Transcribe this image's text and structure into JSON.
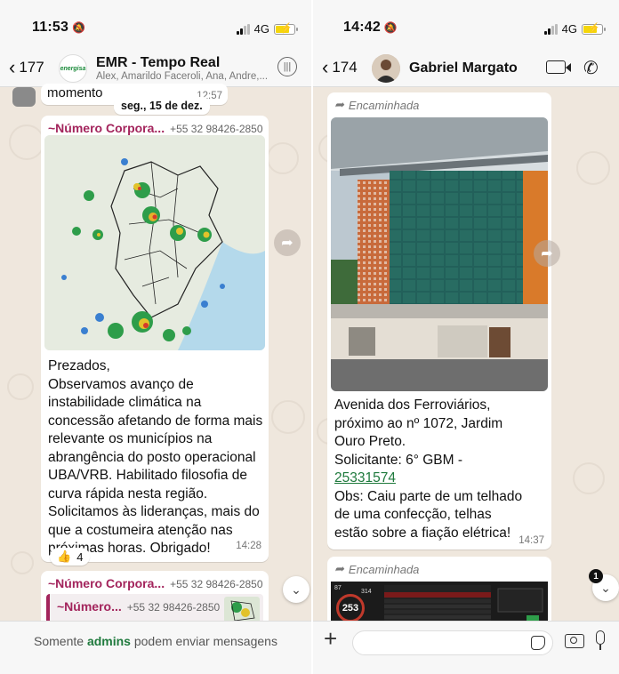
{
  "left": {
    "status": {
      "time": "11:53",
      "network": "4G"
    },
    "header": {
      "back_count": "177",
      "logo_text": "energisa",
      "title": "EMR - Tempo Real",
      "subtitle": "Alex, Amarildo Faceroli, Ana, Andre,..."
    },
    "prev_message": {
      "text": "momento",
      "time": "12:57"
    },
    "date_pill": "seg., 15 de dez.",
    "message": {
      "sender": "~Número Corpora...",
      "phone": "+55 32 98426-2850",
      "lines": [
        "Prezados,",
        "Observamos avanço de",
        "instabilidade climática na",
        "concessão afetando de forma mais",
        "relevante os municípios na",
        "abrangência do posto operacional",
        "UBA/VRB. Habilitado filosofia de",
        "curva rápida nesta região.",
        "Solicitamos às lideranças, mais do",
        "que a costumeira atenção nas",
        "próximas horas. Obrigado!"
      ],
      "time": "14:28",
      "reaction_emoji": "👍",
      "reaction_count": "4"
    },
    "next_message": {
      "sender": "~Número Corpora...",
      "phone": "+55 32 98426-2850",
      "quoted_sender": "~Número...",
      "quoted_phone": "+55 32 98426-2850"
    },
    "footer": {
      "prefix": "Somente ",
      "highlight": "admins",
      "suffix": " podem enviar mensagens"
    }
  },
  "right": {
    "status": {
      "time": "14:42",
      "network": "4G"
    },
    "header": {
      "back_count": "174",
      "title": "Gabriel Margato"
    },
    "message": {
      "forwarded": "Encaminhada",
      "lines": [
        "Avenida dos Ferroviários,",
        "próximo ao nº 1072, Jardim",
        "Ouro Preto."
      ],
      "requester": "Solicitante: 6° GBM -",
      "link": "25331574",
      "obs_lines": [
        "Obs: Caiu parte de um telhado",
        "de uma confecção, telhas",
        "estão sobre a fiação elétrica!"
      ],
      "time": "14:37"
    },
    "next_message": {
      "forwarded": "Encaminhada",
      "badge_left": "87",
      "badge_right": "314",
      "gauge_value": "253"
    },
    "unread_count": "1"
  },
  "colors": {
    "wallpaper": "#efe7dd",
    "sender": "#a3245c",
    "link": "#1f7a3d",
    "battery": "#f5d60a"
  }
}
